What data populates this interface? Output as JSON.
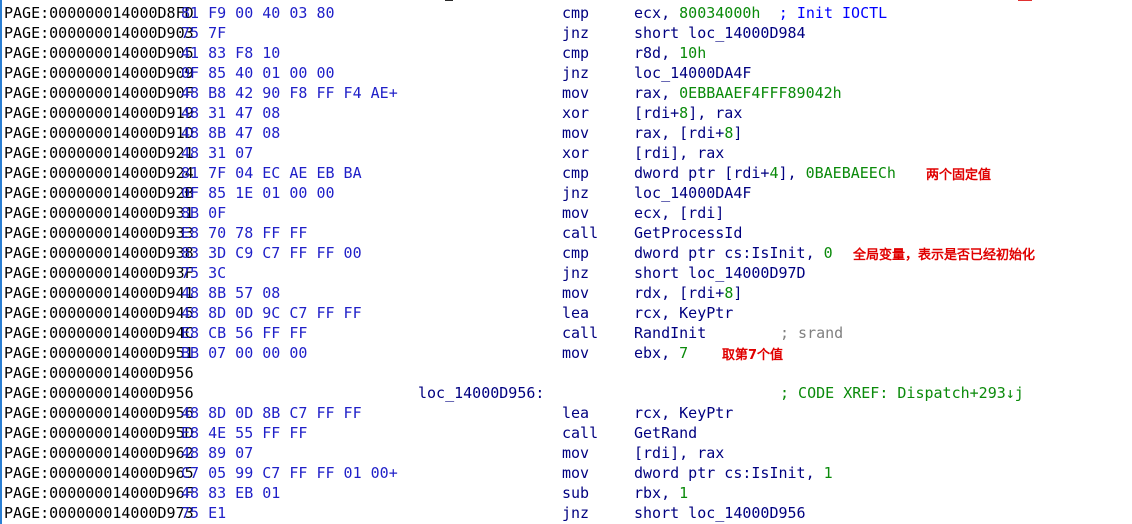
{
  "lines": [
    {
      "addr": "PAGE:000000014000D8FD",
      "bytes": "81 F9 00 40 03 80",
      "label": "",
      "mnem": "cmp",
      "ops": [
        {
          "t": "ecx, ",
          "k": "ref"
        },
        {
          "t": "80034000h",
          "k": "num"
        }
      ],
      "comment": "; Init IOCTL",
      "comment_style": "blue"
    },
    {
      "addr": "PAGE:000000014000D903",
      "bytes": "75 7F",
      "label": "",
      "mnem": "jnz",
      "ops": [
        {
          "t": "short loc_14000D984",
          "k": "ref"
        }
      ],
      "comment": "",
      "comment_style": ""
    },
    {
      "addr": "PAGE:000000014000D905",
      "bytes": "41 83 F8 10",
      "label": "",
      "mnem": "cmp",
      "ops": [
        {
          "t": "r8d, ",
          "k": "ref"
        },
        {
          "t": "10h",
          "k": "num"
        }
      ],
      "comment": "",
      "comment_style": ""
    },
    {
      "addr": "PAGE:000000014000D909",
      "bytes": "0F 85 40 01 00 00",
      "label": "",
      "mnem": "jnz",
      "ops": [
        {
          "t": "loc_14000DA4F",
          "k": "ref"
        }
      ],
      "comment": "",
      "comment_style": ""
    },
    {
      "addr": "PAGE:000000014000D90F",
      "bytes": "48 B8 42 90 F8 FF F4 AE+",
      "label": "",
      "mnem": "mov",
      "ops": [
        {
          "t": "rax, ",
          "k": "ref"
        },
        {
          "t": "0EBBAAEF4FFF89042h",
          "k": "num"
        }
      ],
      "comment": "",
      "comment_style": ""
    },
    {
      "addr": "PAGE:000000014000D919",
      "bytes": "48 31 47 08",
      "label": "",
      "mnem": "xor",
      "ops": [
        {
          "t": "[rdi+",
          "k": "ref"
        },
        {
          "t": "8",
          "k": "num"
        },
        {
          "t": "], rax",
          "k": "ref"
        }
      ],
      "comment": "",
      "comment_style": ""
    },
    {
      "addr": "PAGE:000000014000D91D",
      "bytes": "48 8B 47 08",
      "label": "",
      "mnem": "mov",
      "ops": [
        {
          "t": "rax, [rdi+",
          "k": "ref"
        },
        {
          "t": "8",
          "k": "num"
        },
        {
          "t": "]",
          "k": "ref"
        }
      ],
      "comment": "",
      "comment_style": ""
    },
    {
      "addr": "PAGE:000000014000D921",
      "bytes": "48 31 07",
      "label": "",
      "mnem": "xor",
      "ops": [
        {
          "t": "[rdi], rax",
          "k": "ref"
        }
      ],
      "comment": "",
      "comment_style": ""
    },
    {
      "addr": "PAGE:000000014000D924",
      "bytes": "81 7F 04 EC AE EB BA",
      "label": "",
      "mnem": "cmp",
      "ops": [
        {
          "t": "dword ptr [rdi+",
          "k": "ref"
        },
        {
          "t": "4",
          "k": "num"
        },
        {
          "t": "], ",
          "k": "ref"
        },
        {
          "t": "0BAEBAEECh",
          "k": "num"
        }
      ],
      "comment": "",
      "comment_style": ""
    },
    {
      "addr": "PAGE:000000014000D92B",
      "bytes": "0F 85 1E 01 00 00",
      "label": "",
      "mnem": "jnz",
      "ops": [
        {
          "t": "loc_14000DA4F",
          "k": "ref"
        }
      ],
      "comment": "",
      "comment_style": ""
    },
    {
      "addr": "PAGE:000000014000D931",
      "bytes": "8B 0F",
      "label": "",
      "mnem": "mov",
      "ops": [
        {
          "t": "ecx, [rdi]",
          "k": "ref"
        }
      ],
      "comment": "",
      "comment_style": ""
    },
    {
      "addr": "PAGE:000000014000D933",
      "bytes": "E8 70 78 FF FF",
      "label": "",
      "mnem": "call",
      "ops": [
        {
          "t": "GetProcessId",
          "k": "ref"
        }
      ],
      "comment": "",
      "comment_style": ""
    },
    {
      "addr": "PAGE:000000014000D938",
      "bytes": "83 3D C9 C7 FF FF 00",
      "label": "",
      "mnem": "cmp",
      "ops": [
        {
          "t": "dword ptr cs:IsInit, ",
          "k": "ref"
        },
        {
          "t": "0",
          "k": "num"
        }
      ],
      "comment": "",
      "comment_style": ""
    },
    {
      "addr": "PAGE:000000014000D93F",
      "bytes": "75 3C",
      "label": "",
      "mnem": "jnz",
      "ops": [
        {
          "t": "short loc_14000D97D",
          "k": "ref"
        }
      ],
      "comment": "",
      "comment_style": ""
    },
    {
      "addr": "PAGE:000000014000D941",
      "bytes": "48 8B 57 08",
      "label": "",
      "mnem": "mov",
      "ops": [
        {
          "t": "rdx, [rdi+",
          "k": "ref"
        },
        {
          "t": "8",
          "k": "num"
        },
        {
          "t": "]",
          "k": "ref"
        }
      ],
      "comment": "",
      "comment_style": ""
    },
    {
      "addr": "PAGE:000000014000D945",
      "bytes": "48 8D 0D 9C C7 FF FF",
      "label": "",
      "mnem": "lea",
      "ops": [
        {
          "t": "rcx, KeyPtr",
          "k": "ref"
        }
      ],
      "comment": "",
      "comment_style": ""
    },
    {
      "addr": "PAGE:000000014000D94C",
      "bytes": "E8 CB 56 FF FF",
      "label": "",
      "mnem": "call",
      "ops": [
        {
          "t": "RandInit",
          "k": "ref"
        }
      ],
      "comment": "; srand",
      "comment_style": "gray"
    },
    {
      "addr": "PAGE:000000014000D951",
      "bytes": "BB 07 00 00 00",
      "label": "",
      "mnem": "mov",
      "ops": [
        {
          "t": "ebx, ",
          "k": "ref"
        },
        {
          "t": "7",
          "k": "num"
        }
      ],
      "comment": "",
      "comment_style": ""
    },
    {
      "addr": "PAGE:000000014000D956",
      "bytes": "",
      "label": "",
      "mnem": "",
      "ops": [],
      "comment": "",
      "comment_style": ""
    },
    {
      "addr": "PAGE:000000014000D956",
      "bytes": "",
      "label": "loc_14000D956:",
      "mnem": "",
      "ops": [],
      "comment": "; CODE XREF: Dispatch+293↓j",
      "comment_style": "green"
    },
    {
      "addr": "PAGE:000000014000D956",
      "bytes": "48 8D 0D 8B C7 FF FF",
      "label": "",
      "mnem": "lea",
      "ops": [
        {
          "t": "rcx, KeyPtr",
          "k": "ref"
        }
      ],
      "comment": "",
      "comment_style": ""
    },
    {
      "addr": "PAGE:000000014000D95D",
      "bytes": "E8 4E 55 FF FF",
      "label": "",
      "mnem": "call",
      "ops": [
        {
          "t": "GetRand",
          "k": "ref"
        }
      ],
      "comment": "",
      "comment_style": ""
    },
    {
      "addr": "PAGE:000000014000D962",
      "bytes": "48 89 07",
      "label": "",
      "mnem": "mov",
      "ops": [
        {
          "t": "[rdi], rax",
          "k": "ref"
        }
      ],
      "comment": "",
      "comment_style": ""
    },
    {
      "addr": "PAGE:000000014000D965",
      "bytes": "C7 05 99 C7 FF FF 01 00+",
      "label": "",
      "mnem": "mov",
      "ops": [
        {
          "t": "dword ptr cs:IsInit, ",
          "k": "ref"
        },
        {
          "t": "1",
          "k": "num"
        }
      ],
      "comment": "",
      "comment_style": ""
    },
    {
      "addr": "PAGE:000000014000D96F",
      "bytes": "48 83 EB 01",
      "label": "",
      "mnem": "sub",
      "ops": [
        {
          "t": "rbx, ",
          "k": "ref"
        },
        {
          "t": "1",
          "k": "num"
        }
      ],
      "comment": "",
      "comment_style": ""
    },
    {
      "addr": "PAGE:000000014000D973",
      "bytes": "75 E1",
      "label": "",
      "mnem": "jnz",
      "ops": [
        {
          "t": "short loc_14000D956",
          "k": "ref"
        }
      ],
      "comment": "",
      "comment_style": ""
    }
  ],
  "annotations": [
    {
      "text": "两个固定值",
      "line": 8
    },
    {
      "text": "全局变量，表示是否已经初始化",
      "line": 12
    },
    {
      "text": "取第7个值",
      "line": 17
    }
  ],
  "colors": {
    "address": "#000000",
    "bytes": "#1f1fc8",
    "instruction": "#000080",
    "number": "#0a8a0a",
    "comment_blue": "#0000ff",
    "comment_gray": "#808080",
    "annotation": "#e00000",
    "gutter": "#2a7fd4",
    "background": "#ffffff"
  }
}
